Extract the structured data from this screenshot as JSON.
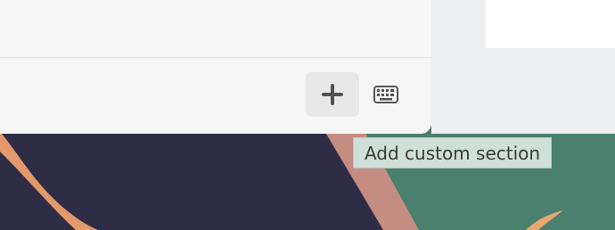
{
  "toolbar": {
    "add_button_icon": "plus-icon",
    "keyboard_button_icon": "keyboard-icon"
  },
  "tooltip": {
    "text": "Add custom section"
  },
  "colors": {
    "window_bg": "#f7f7f7",
    "add_button_bg": "#e8e8e8",
    "tooltip_bg": "#cfe0d8",
    "wallpaper_dark": "#2e2c45",
    "wallpaper_green": "#4a7d6c",
    "wallpaper_orange": "#e29a6c"
  }
}
